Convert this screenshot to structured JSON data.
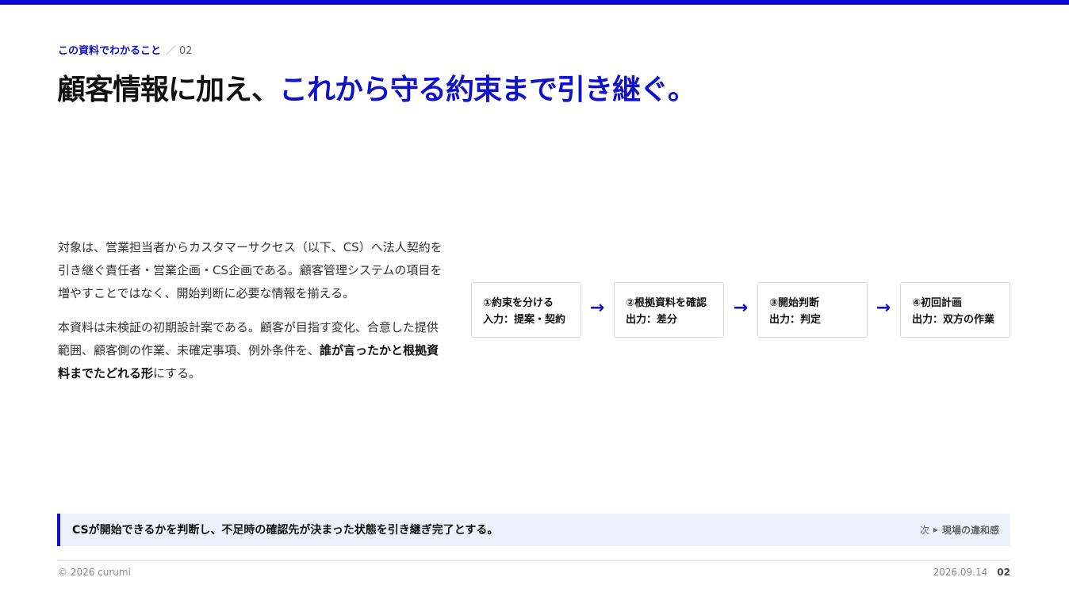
{
  "header": {
    "eyebrow_label": "この資料でわかること",
    "eyebrow_sep": "／",
    "eyebrow_num": "02",
    "title_plain": "顧客情報に加え、",
    "title_accent": "これから守る約束まで引き継ぐ。"
  },
  "body": {
    "p1": "対象は、営業担当者からカスタマーサクセス（以下、CS）へ法人契約を引き継ぐ責任者・営業企画・CS企画である。顧客管理システムの項目を増やすことではなく、開始判断に必要な情報を揃える。",
    "p2_pre": "本資料は未検証の初期設計案である。顧客が目指す変化、合意した提供範囲、顧客側の作業、未確定事項、例外条件を、",
    "p2_bold": "誰が言ったかと根拠資料までたどれる形",
    "p2_post": "にする。"
  },
  "flow": {
    "steps": [
      {
        "title": "①約束を分ける",
        "detail": "入力：提案・契約"
      },
      {
        "title": "②根拠資料を確認",
        "detail": "出力：差分"
      },
      {
        "title": "③開始判断",
        "detail": "出力：判定"
      },
      {
        "title": "④初回計画",
        "detail": "出力：双方の作業"
      }
    ],
    "arrow": "→"
  },
  "summary": {
    "text": "CSが開始できるかを判断し、不足時の確認先が決まった状態を引き継ぎ完了とする。",
    "next_prefix": "次",
    "next_label": "現場の違和感"
  },
  "footer": {
    "copyright": "© 2026 curumi",
    "date": "2026.09.14",
    "page": "02"
  },
  "colors": {
    "accent": "#1010c8",
    "summary_bg": "#eef1fc"
  }
}
